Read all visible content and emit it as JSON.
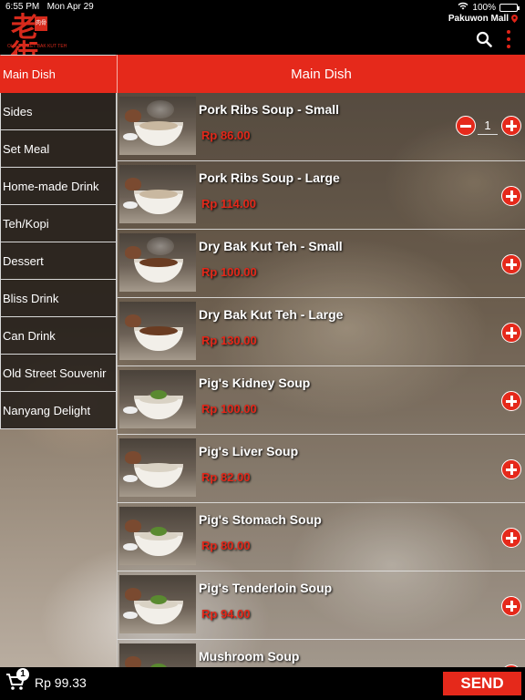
{
  "status": {
    "time": "6:55 PM",
    "date": "Mon Apr 29",
    "battery": "100%"
  },
  "header": {
    "logo_text": "老街",
    "logo_badge": "肉骨",
    "logo_sub": "OLD STREET BAK KUT TEH",
    "location": "Pakuwon Mall"
  },
  "sidebar": {
    "items": [
      {
        "label": "Main Dish"
      },
      {
        "label": "Sides"
      },
      {
        "label": "Set Meal"
      },
      {
        "label": "Home-made Drink"
      },
      {
        "label": "Teh/Kopi"
      },
      {
        "label": "Dessert"
      },
      {
        "label": "Bliss Drink"
      },
      {
        "label": "Can Drink"
      },
      {
        "label": "Old Street Souvenir"
      },
      {
        "label": "Nanyang Delight"
      }
    ]
  },
  "section": {
    "title": "Main Dish"
  },
  "products": [
    {
      "name": "Pork Ribs Soup - Small",
      "price": "Rp 86.00",
      "quantity": "1"
    },
    {
      "name": "Pork Ribs Soup - Large",
      "price": "Rp 114.00"
    },
    {
      "name": "Dry Bak Kut Teh - Small",
      "price": "Rp 100.00"
    },
    {
      "name": "Dry Bak Kut Teh - Large",
      "price": "Rp 130.00"
    },
    {
      "name": "Pig's Kidney Soup",
      "price": "Rp 100.00"
    },
    {
      "name": "Pig's Liver Soup",
      "price": "Rp 82.00"
    },
    {
      "name": "Pig's Stomach Soup",
      "price": "Rp 80.00"
    },
    {
      "name": "Pig's Tenderloin Soup",
      "price": "Rp 94.00"
    },
    {
      "name": "Mushroom Soup",
      "price": ""
    }
  ],
  "footer": {
    "cart_count": "1",
    "total": "Rp 99.33",
    "send_label": "SEND"
  },
  "colors": {
    "accent": "#e5291b",
    "price": "#e3281a",
    "bar": "#000000"
  }
}
